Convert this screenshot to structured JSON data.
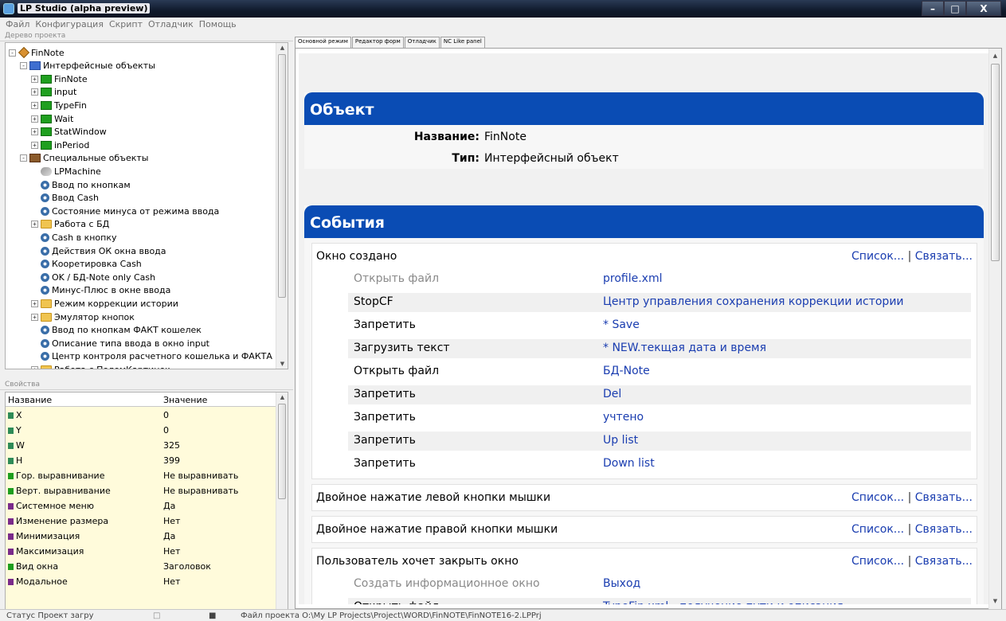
{
  "app": {
    "title": "LP Studio (alpha preview)",
    "window_buttons": [
      "–",
      "□",
      "X"
    ]
  },
  "menu": [
    "Файл",
    "Конфигурация",
    "Скрипт",
    "Отладчик",
    "Помощь"
  ],
  "tree": {
    "header": "Дерево проекта",
    "items": [
      {
        "label": "FinNote",
        "icon": "root-icon"
      },
      {
        "label": "Интерфейсные объекты",
        "icon": "screen-icon"
      },
      {
        "label": "FinNote",
        "icon": "form-icon"
      },
      {
        "label": "input",
        "icon": "form-icon"
      },
      {
        "label": "TypeFin",
        "icon": "form-icon"
      },
      {
        "label": "Wait",
        "icon": "form-icon"
      },
      {
        "label": "StatWindow",
        "icon": "form-icon"
      },
      {
        "label": "inPeriod",
        "icon": "form-icon"
      },
      {
        "label": "Специальные объекты",
        "icon": "special-objects-icon"
      },
      {
        "label": "LPMachine",
        "icon": "machine-icon"
      },
      {
        "label": "Ввод по кнопкам",
        "icon": "script-icon"
      },
      {
        "label": "Ввод Cash",
        "icon": "script-icon"
      },
      {
        "label": "Состояние минуса от режима ввода",
        "icon": "script-icon"
      },
      {
        "label": "Работа с БД",
        "icon": "folder-icon"
      },
      {
        "label": "Cash в кнопку",
        "icon": "script-icon"
      },
      {
        "label": "Действия ОК окна ввода",
        "icon": "script-icon"
      },
      {
        "label": "Кооретировка Cash",
        "icon": "script-icon"
      },
      {
        "label": "OK / БД-Note only Cash",
        "icon": "script-icon"
      },
      {
        "label": "Минус-Плюс в окне ввода",
        "icon": "script-icon"
      },
      {
        "label": "Режим коррекции истории",
        "icon": "folder-icon"
      },
      {
        "label": "Эмулятор кнопок",
        "icon": "folder-icon"
      },
      {
        "label": "Ввод по кнопкам ФАКТ кошелек",
        "icon": "script-icon"
      },
      {
        "label": "Описание типа ввода в окно input",
        "icon": "script-icon"
      },
      {
        "label": "Центр контроля расчетного кошелька и ФАКТА",
        "icon": "script-icon"
      },
      {
        "label": "Работа с ПолемКартинок",
        "icon": "folder-icon"
      }
    ]
  },
  "properties": {
    "header": "Свойства",
    "col_name": "Название",
    "col_value": "Значение",
    "rows": [
      {
        "name": "X",
        "value": "0",
        "color": "#2e8b57"
      },
      {
        "name": "Y",
        "value": "0",
        "color": "#2e8b57"
      },
      {
        "name": "W",
        "value": "325",
        "color": "#2e8b57"
      },
      {
        "name": "H",
        "value": "399",
        "color": "#2e8b57"
      },
      {
        "name": "Гор. выравнивание",
        "value": "Не выравнивать",
        "color": "#1e9e1e"
      },
      {
        "name": "Верт. выравнивание",
        "value": "Не выравнивать",
        "color": "#1e9e1e"
      },
      {
        "name": "Системное меню",
        "value": "Да",
        "color": "#7a2a8a"
      },
      {
        "name": "Изменение размера",
        "value": "Нет",
        "color": "#7a2a8a"
      },
      {
        "name": "Минимизация",
        "value": "Да",
        "color": "#7a2a8a"
      },
      {
        "name": "Максимизация",
        "value": "Нет",
        "color": "#7a2a8a"
      },
      {
        "name": "Вид окна",
        "value": "Заголовок",
        "color": "#1e9e1e"
      },
      {
        "name": "Модальное",
        "value": "Нет",
        "color": "#7a2a8a"
      }
    ]
  },
  "tabs": [
    "Основной режим",
    "Редактор форм",
    "Отладчик",
    "NC Like panel"
  ],
  "object_card": {
    "title": "Объект",
    "name_label": "Название:",
    "name_value": "FinNote",
    "type_label": "Тип:",
    "type_value": "Интерфейсный объект"
  },
  "events_card": {
    "title": "События",
    "list_link": "Список...",
    "bind_link": "Связать...",
    "events": [
      {
        "title": "Окно создано",
        "actions": [
          {
            "action": "Открыть файл",
            "target": "profile.xml",
            "dim": true
          },
          {
            "action": "StopCF",
            "target": "Центр управления сохранения коррекции истории",
            "dim": false
          },
          {
            "action": "Запретить",
            "target": "* Save",
            "dim": false
          },
          {
            "action": "Загрузить текст",
            "target": "* NEW.текщая дата и время",
            "dim": false
          },
          {
            "action": "Открыть файл",
            "target": "БД-Note",
            "dim": false
          },
          {
            "action": "Запретить",
            "target": "Del",
            "dim": false
          },
          {
            "action": "Запретить",
            "target": "учтено",
            "dim": false
          },
          {
            "action": "Запретить",
            "target": "Up list",
            "dim": false
          },
          {
            "action": "Запретить",
            "target": "Down list",
            "dim": false
          }
        ]
      },
      {
        "title": "Двойное нажатие левой кнопки мышки",
        "actions": []
      },
      {
        "title": "Двойное нажатие правой кнопки мышки",
        "actions": []
      },
      {
        "title": "Пользователь хочет закрыть окно",
        "actions": [
          {
            "action": "Создать информационное окно",
            "target": "Выход",
            "dim": true
          },
          {
            "action": "Открыть файл",
            "target": "TypeFin.xml - получение пути и описания",
            "dim": false
          }
        ]
      }
    ]
  },
  "status": {
    "left": "Статус Проект загру",
    "path": "Файл проекта O:\\My LP Projects\\Project\\WORD\\FinNOTE\\FinNOTE16-2.LPPrj"
  }
}
